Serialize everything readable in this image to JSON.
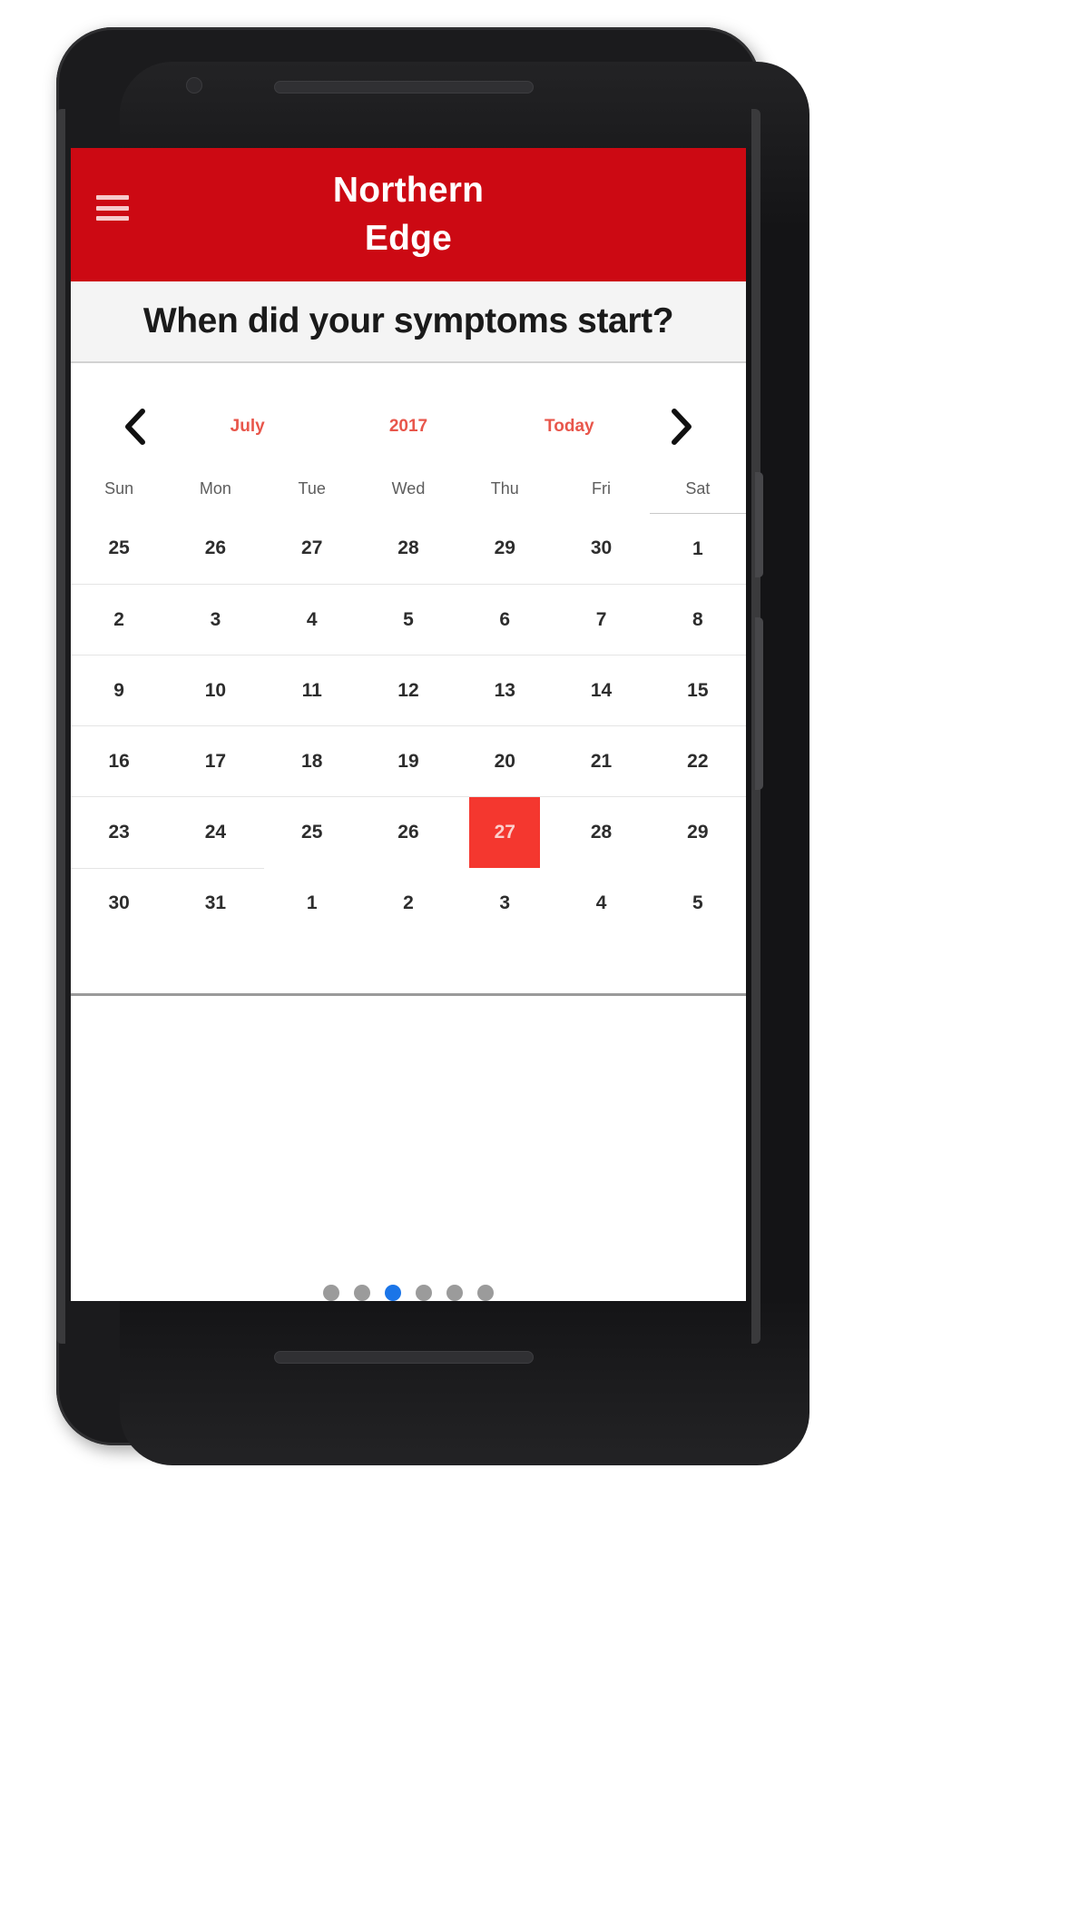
{
  "app": {
    "title_line1": "Northern",
    "title_line2": "Edge",
    "menu_icon": "hamburger-menu-icon",
    "header_color": "#CC0913"
  },
  "question": {
    "text": "When did your symptoms start?"
  },
  "calendar": {
    "prev_icon": "chevron-left-icon",
    "next_icon": "chevron-right-icon",
    "month": "July",
    "year": "2017",
    "today_label": "Today",
    "accent_color": "#e8564b",
    "selected_color": "#F4372F",
    "weekdays": [
      "Sun",
      "Mon",
      "Tue",
      "Wed",
      "Thu",
      "Fri",
      "Sat"
    ],
    "selected_day": "27",
    "weeks": [
      [
        {
          "d": "25",
          "muted": true
        },
        {
          "d": "26",
          "muted": true
        },
        {
          "d": "27",
          "muted": true
        },
        {
          "d": "28",
          "muted": true
        },
        {
          "d": "29",
          "muted": true
        },
        {
          "d": "30",
          "muted": true
        },
        {
          "d": "1",
          "muted": false
        }
      ],
      [
        {
          "d": "2",
          "muted": false
        },
        {
          "d": "3",
          "muted": false
        },
        {
          "d": "4",
          "muted": false
        },
        {
          "d": "5",
          "muted": false
        },
        {
          "d": "6",
          "muted": false
        },
        {
          "d": "7",
          "muted": false
        },
        {
          "d": "8",
          "muted": false
        }
      ],
      [
        {
          "d": "9",
          "muted": false
        },
        {
          "d": "10",
          "muted": false
        },
        {
          "d": "11",
          "muted": false
        },
        {
          "d": "12",
          "muted": false
        },
        {
          "d": "13",
          "muted": false
        },
        {
          "d": "14",
          "muted": false
        },
        {
          "d": "15",
          "muted": false
        }
      ],
      [
        {
          "d": "16",
          "muted": false
        },
        {
          "d": "17",
          "muted": false
        },
        {
          "d": "18",
          "muted": false
        },
        {
          "d": "19",
          "muted": false
        },
        {
          "d": "20",
          "muted": false
        },
        {
          "d": "21",
          "muted": false
        },
        {
          "d": "22",
          "muted": false
        }
      ],
      [
        {
          "d": "23",
          "muted": false
        },
        {
          "d": "24",
          "muted": false
        },
        {
          "d": "25",
          "muted": false
        },
        {
          "d": "26",
          "muted": false
        },
        {
          "d": "27",
          "muted": false,
          "selected": true
        },
        {
          "d": "28",
          "muted": false
        },
        {
          "d": "29",
          "muted": false
        }
      ],
      [
        {
          "d": "30",
          "muted": false
        },
        {
          "d": "31",
          "muted": false
        },
        {
          "d": "1",
          "muted": true
        },
        {
          "d": "2",
          "muted": true
        },
        {
          "d": "3",
          "muted": true
        },
        {
          "d": "4",
          "muted": true
        },
        {
          "d": "5",
          "muted": true
        }
      ]
    ]
  },
  "pagination": {
    "total": 6,
    "active_index": 2,
    "active_color": "#1b75e8",
    "inactive_color": "#9b9b9b"
  }
}
